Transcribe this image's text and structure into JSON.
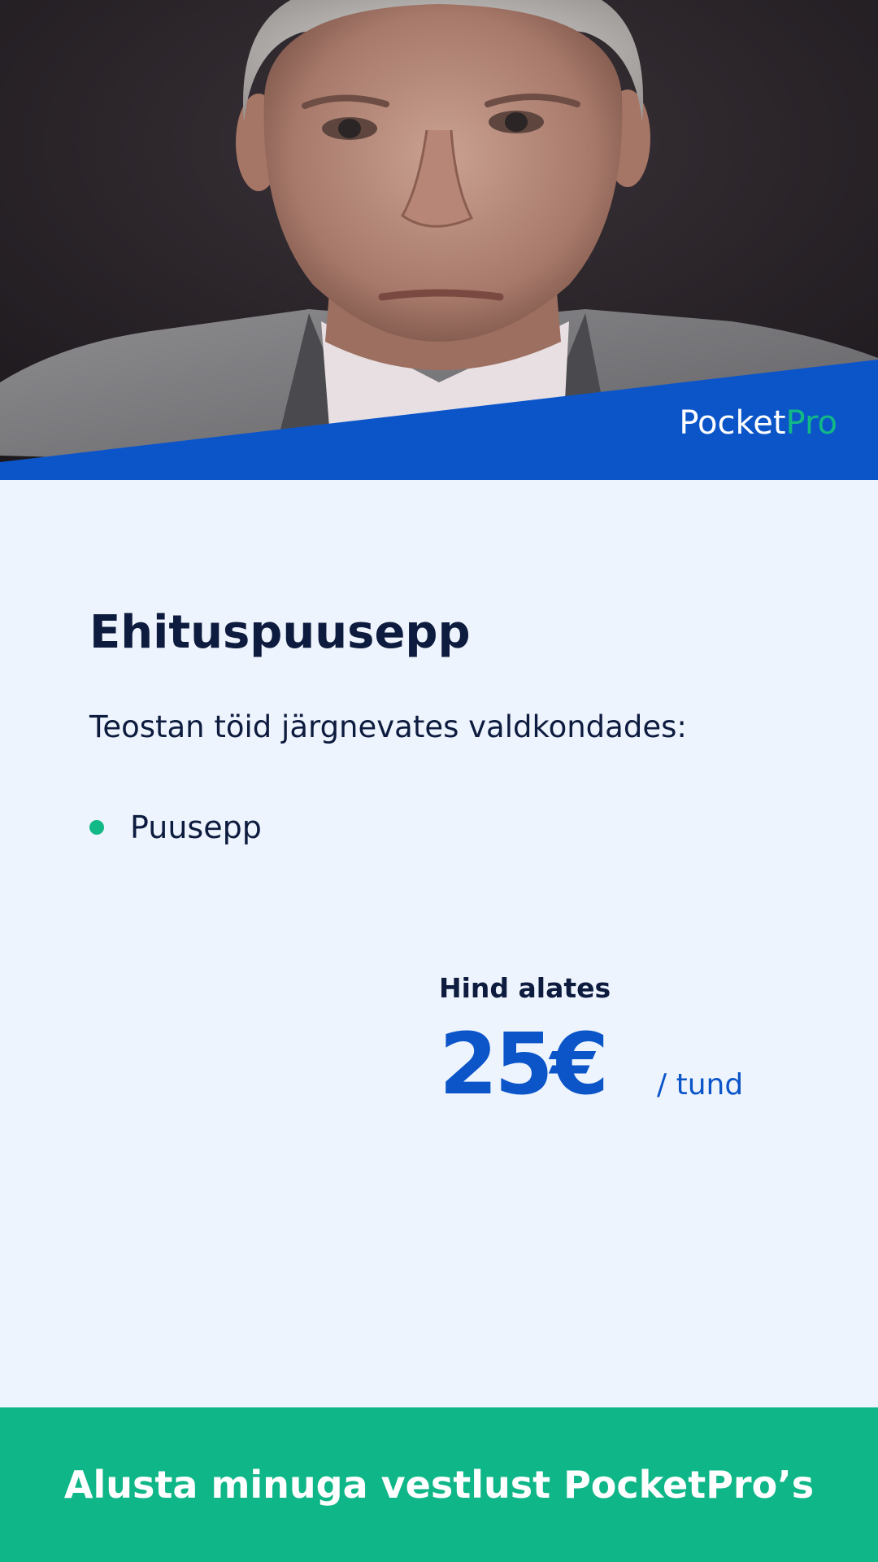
{
  "brand": {
    "name_part1": "Pocket",
    "name_part2": "Pro",
    "color_primary": "#0b55c9",
    "color_accent": "#12b886"
  },
  "profile": {
    "photo_alt": "Profile photo",
    "title": "Ehituspuusepp",
    "intro": "Teostan töid järgnevates valdkondades:",
    "services": [
      {
        "label": "Puusepp"
      }
    ]
  },
  "price": {
    "caption": "Hind alates",
    "amount": "25€",
    "unit": "/ tund"
  },
  "cta": {
    "label": "Alusta minuga vestlust PocketPro’s"
  }
}
